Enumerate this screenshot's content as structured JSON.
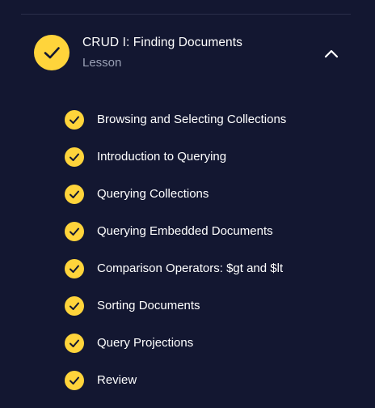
{
  "lesson": {
    "title": "CRUD I: Finding Documents",
    "subtitle": "Lesson",
    "status_icon": "check-circle-icon",
    "toggle_icon": "chevron-up-icon",
    "expanded": true
  },
  "items": [
    {
      "label": "Browsing and Selecting Collections",
      "completed": true
    },
    {
      "label": "Introduction to Querying",
      "completed": true
    },
    {
      "label": "Querying Collections",
      "completed": true
    },
    {
      "label": "Querying Embedded Documents",
      "completed": true
    },
    {
      "label": "Comparison Operators: $gt and $lt",
      "completed": true
    },
    {
      "label": "Sorting Documents",
      "completed": true
    },
    {
      "label": "Query Projections",
      "completed": true
    },
    {
      "label": "Review",
      "completed": true
    }
  ],
  "colors": {
    "background": "#131731",
    "accent": "#ffd43b",
    "text": "#ffffff",
    "muted_text": "#9aa0b5"
  }
}
